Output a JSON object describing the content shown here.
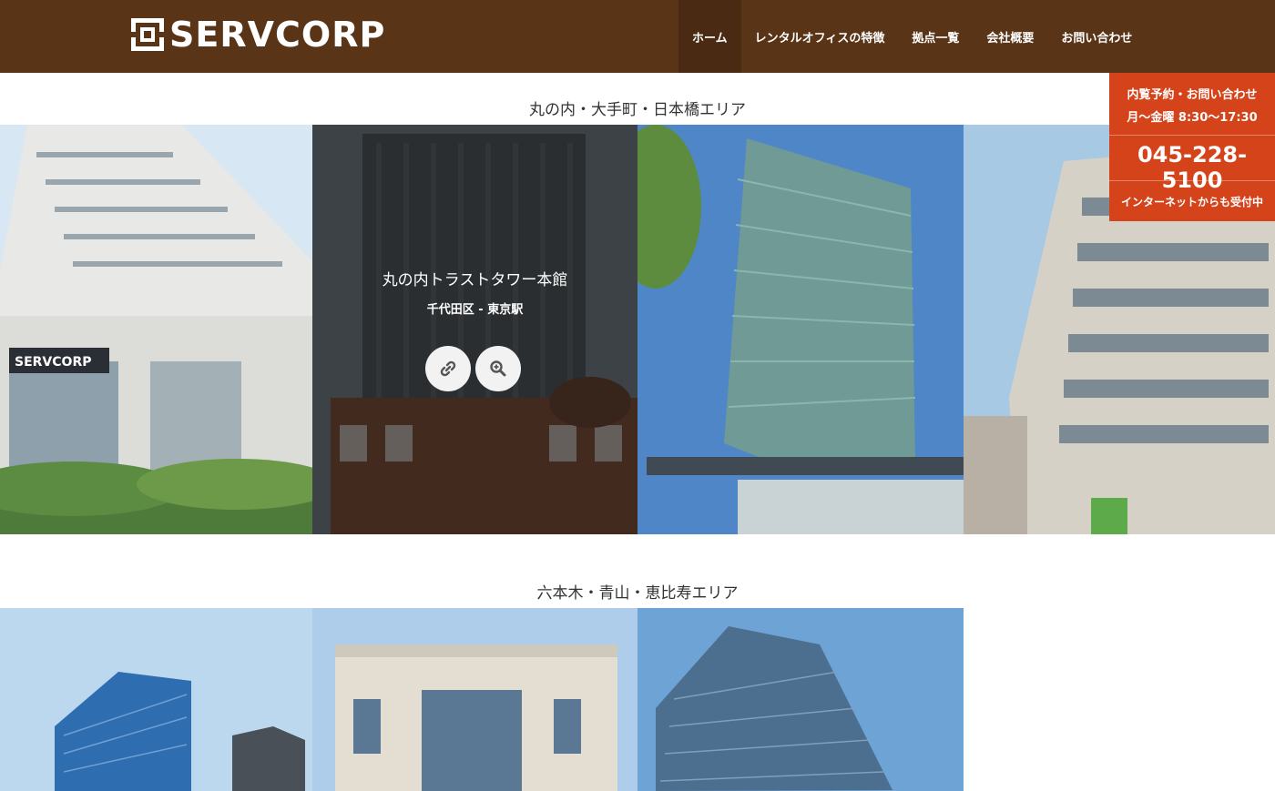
{
  "brand": {
    "name": "SERVCORP"
  },
  "nav": {
    "items": [
      {
        "label": "ホーム",
        "active": true
      },
      {
        "label": "レンタルオフィスの特徴",
        "active": false
      },
      {
        "label": "拠点一覧",
        "active": false
      },
      {
        "label": "会社概要",
        "active": false
      },
      {
        "label": "お問い合わせ",
        "active": false
      }
    ]
  },
  "areas": [
    {
      "title": "丸の内・大手町・日本橋エリア"
    },
    {
      "title": "六本木・青山・恵比寿エリア"
    }
  ],
  "featured": {
    "title": "丸の内トラストタワー本館",
    "subtitle": "千代田区 - 東京駅",
    "link_icon": "link-icon",
    "zoom_icon": "zoom-in-icon"
  },
  "contact": {
    "line1": "内覧予約・お問い合わせ",
    "hours": "月〜金曜 8:30〜17:30",
    "phone": "045-228-5100",
    "note": "インターネットからも受付中"
  },
  "colors": {
    "nav_bg": "#5a3417",
    "nav_active": "#4a2a12",
    "contact_bg": "#d5431b"
  }
}
